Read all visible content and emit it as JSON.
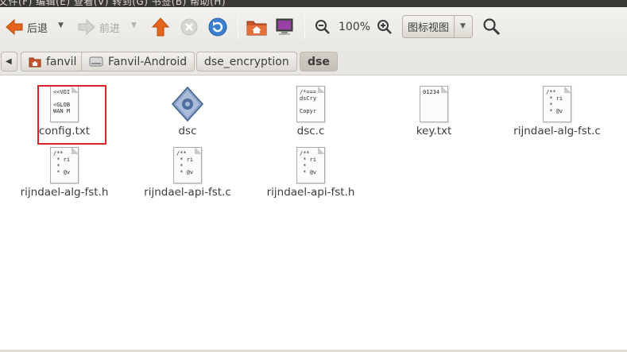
{
  "menubar": {
    "text": "文件(F)  编辑(E)  查看(V)  转到(G)  书签(B)  帮助(H)"
  },
  "toolbar": {
    "back_label": "后退",
    "forward_label": "前进",
    "zoom_level": "100%",
    "view_mode": "图标视图",
    "icons": [
      "back-arrow-icon",
      "forward-arrow-icon",
      "home-icon",
      "stop-icon",
      "reload-icon",
      "folder-home-icon",
      "computer-icon",
      "zoom-out-icon",
      "zoom-in-icon",
      "search-icon"
    ]
  },
  "breadcrumbs": [
    {
      "label": "fanvil",
      "icon": "folder-home-icon"
    },
    {
      "label": "Fanvil-Android",
      "icon": "drive-icon"
    },
    {
      "label": "dse_encryption"
    },
    {
      "label": "dse",
      "active": true
    }
  ],
  "files": [
    {
      "name": "config.txt",
      "preview": "<<VOI\n\n<GLOB\nWAN M",
      "selected": true
    },
    {
      "name": "dsc",
      "type": "executable"
    },
    {
      "name": "dsc.c",
      "preview": "/*===\ndsCry\n\nCopyr"
    },
    {
      "name": "key.txt",
      "preview": "01234"
    },
    {
      "name": "rijndael-alg-fst.c",
      "preview": "/**\n * ri\n *\n * @v"
    },
    {
      "name": "rijndael-alg-fst.h",
      "preview": "/**\n * ri\n *\n * @v"
    },
    {
      "name": "rijndael-api-fst.c",
      "preview": "/**\n * ri\n *\n * @v"
    },
    {
      "name": "rijndael-api-fst.h",
      "preview": "/**\n * ri\n *\n * @v"
    }
  ],
  "colors": {
    "accent_orange": "#e8641d",
    "selection_red": "#d8232a",
    "reload_blue": "#3b7fd1"
  }
}
